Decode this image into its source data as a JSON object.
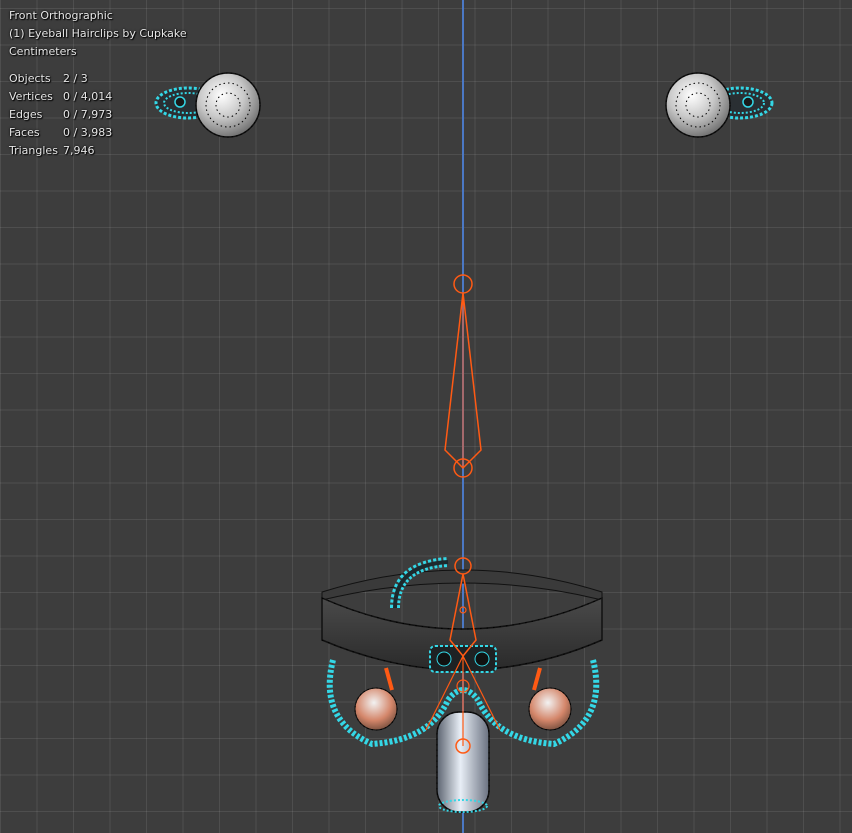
{
  "viewport": {
    "view_name": "Front Orthographic",
    "object_name": "(1) Eyeball Hairclips by Cupkake",
    "units": "Centimeters"
  },
  "stats": [
    {
      "label": "Objects",
      "value": "2 / 3"
    },
    {
      "label": "Vertices",
      "value": "0 / 4,014"
    },
    {
      "label": "Edges",
      "value": "0 / 7,973"
    },
    {
      "label": "Faces",
      "value": "0 / 3,983"
    },
    {
      "label": "Triangles",
      "value": "7,946"
    }
  ],
  "colors": {
    "background": "#3d3d3d",
    "grid": "#4a4a4a",
    "z_axis": "#4b78c4",
    "selection_cyan": "#34d7e6",
    "armature_orange": "#ff5a14",
    "vertex": "#000000"
  }
}
